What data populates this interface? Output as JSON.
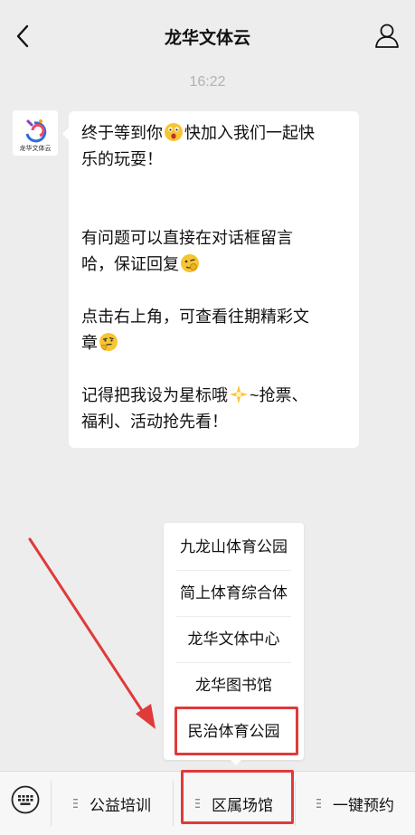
{
  "nav": {
    "title": "龙华文体云",
    "back_icon": "chevron-left-icon",
    "profile_icon": "person-icon"
  },
  "chat": {
    "timestamp": "16:22",
    "avatar_logo_text": "龙华文体云",
    "message": {
      "line1a": "终于等到你",
      "line1b": "快加入我们一起快",
      "line2": "乐的玩耍！",
      "line3": "有问题可以直接在对话框留言",
      "line4": "哈，保证回复",
      "line5": "点击右上角，可查看往期精彩文",
      "line6": "章",
      "line7a": "记得把我设为星标哦",
      "line7b": "~抢票、",
      "line8": "福利、活动抢先看！"
    }
  },
  "menu": {
    "items": [
      "九龙山体育公园",
      "简上体育综合体",
      "龙华文体中心",
      "龙华图书馆",
      "民治体育公园"
    ]
  },
  "bottom": {
    "tabs": [
      "公益培训",
      "区属场馆",
      "一键预约"
    ],
    "keyboard_icon": "keyboard-icon"
  },
  "colors": {
    "highlight": "#e03a3a",
    "background": "#ededed"
  }
}
